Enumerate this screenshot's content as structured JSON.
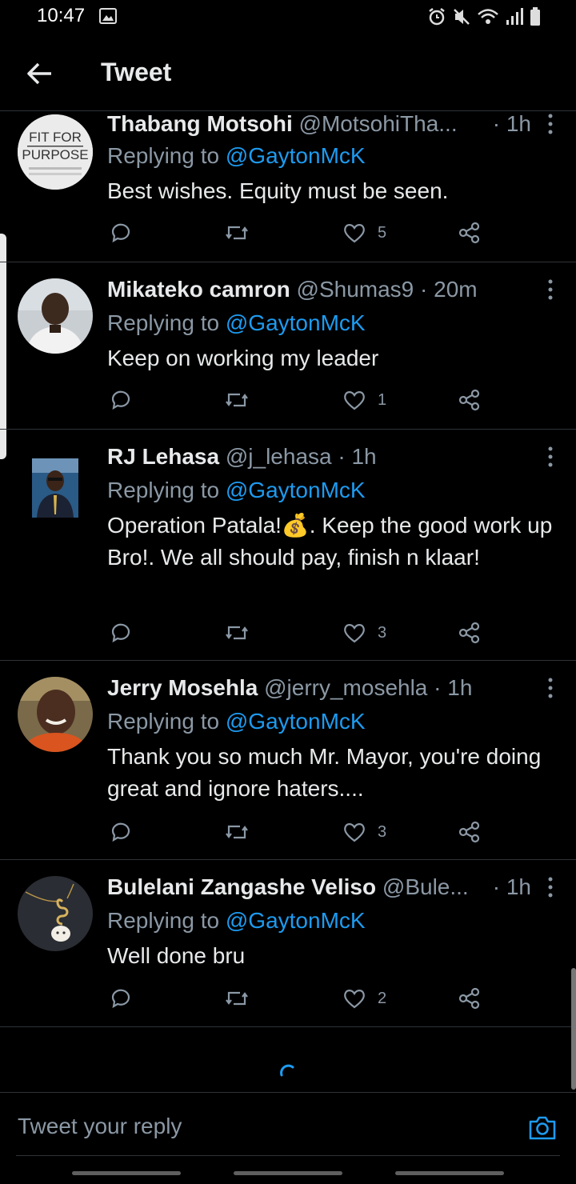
{
  "status_bar": {
    "time": "10:47"
  },
  "header": {
    "title": "Tweet"
  },
  "tweets": [
    {
      "name": "Thabang Motsohi",
      "handle": "@MotsohiTha...",
      "time": "1h",
      "replying_prefix": "Replying to ",
      "mention": "@GaytonMcK",
      "text": "Best wishes. Equity must be seen.",
      "likes": "5",
      "avatar_text": [
        "FIT FOR",
        "PURPOSE"
      ]
    },
    {
      "name": "Mikateko camron",
      "handle": "@Shumas9",
      "time": "20m",
      "replying_prefix": "Replying to ",
      "mention": "@GaytonMcK",
      "text": "Keep on working  my leader",
      "likes": "1"
    },
    {
      "name": "RJ Lehasa",
      "handle": "@j_lehasa",
      "time": "1h",
      "replying_prefix": "Replying to ",
      "mention": "@GaytonMcK",
      "text": "Operation Patala!💰. Keep the good work up Bro!.  We all should pay, finish n klaar!",
      "likes": "3"
    },
    {
      "name": "Jerry Mosehla",
      "handle": "@jerry_mosehla",
      "time": "1h",
      "replying_prefix": "Replying to ",
      "mention": "@GaytonMcK",
      "text": "Thank you so much Mr. Mayor, you're doing great and ignore haters....",
      "likes": "3"
    },
    {
      "name": "Bulelani Zangashe Veliso",
      "handle": "@Bule...",
      "time": "1h",
      "replying_prefix": "Replying to ",
      "mention": "@GaytonMcK",
      "text": "Well done bru",
      "likes": "2"
    }
  ],
  "composer": {
    "placeholder": "Tweet your reply"
  },
  "colors": {
    "background": "#000000",
    "accent": "#1d9bf0",
    "muted": "#8b98a5",
    "divider": "#2f3336"
  },
  "icons": {
    "back": "arrow-left-icon",
    "more": "more-vertical-icon",
    "reply": "reply-icon",
    "retweet": "retweet-icon",
    "like": "heart-icon",
    "share": "share-icon",
    "camera": "camera-icon"
  }
}
